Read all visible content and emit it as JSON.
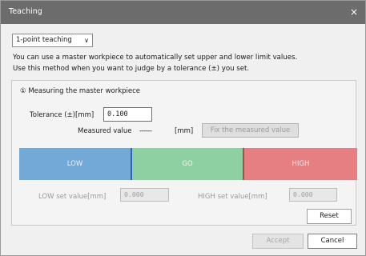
{
  "window": {
    "title": "Teaching",
    "close_glyph": "×"
  },
  "mode_select": {
    "value": "1-point teaching",
    "chevron": "∨"
  },
  "description": {
    "line1": "You can use a master workpiece to automatically set upper and lower limit values.",
    "line2": "Use this method when you want to judge by a tolerance (±) you set."
  },
  "section": {
    "title": "① Measuring the master workpiece",
    "tolerance_label": "Tolerance (±)[mm]",
    "tolerance_value": "0.100",
    "measured_label": "Measured value",
    "measured_value": "------",
    "measured_unit": "[mm]",
    "fix_button": "Fix the measured value",
    "zones": {
      "low": "LOW",
      "go": "GO",
      "high": "HIGH"
    },
    "low_set_label": "LOW set value[mm]",
    "low_set_value": "0.000",
    "high_set_label": "HIGH set value[mm]",
    "high_set_value": "0.000",
    "reset_button": "Reset"
  },
  "footer": {
    "accept_button": "Accept",
    "cancel_button": "Cancel"
  },
  "colors": {
    "titlebar": "#6c6c6c",
    "zone_low": "#73a9d6",
    "zone_go": "#8fd0a3",
    "zone_high": "#e57f82"
  }
}
